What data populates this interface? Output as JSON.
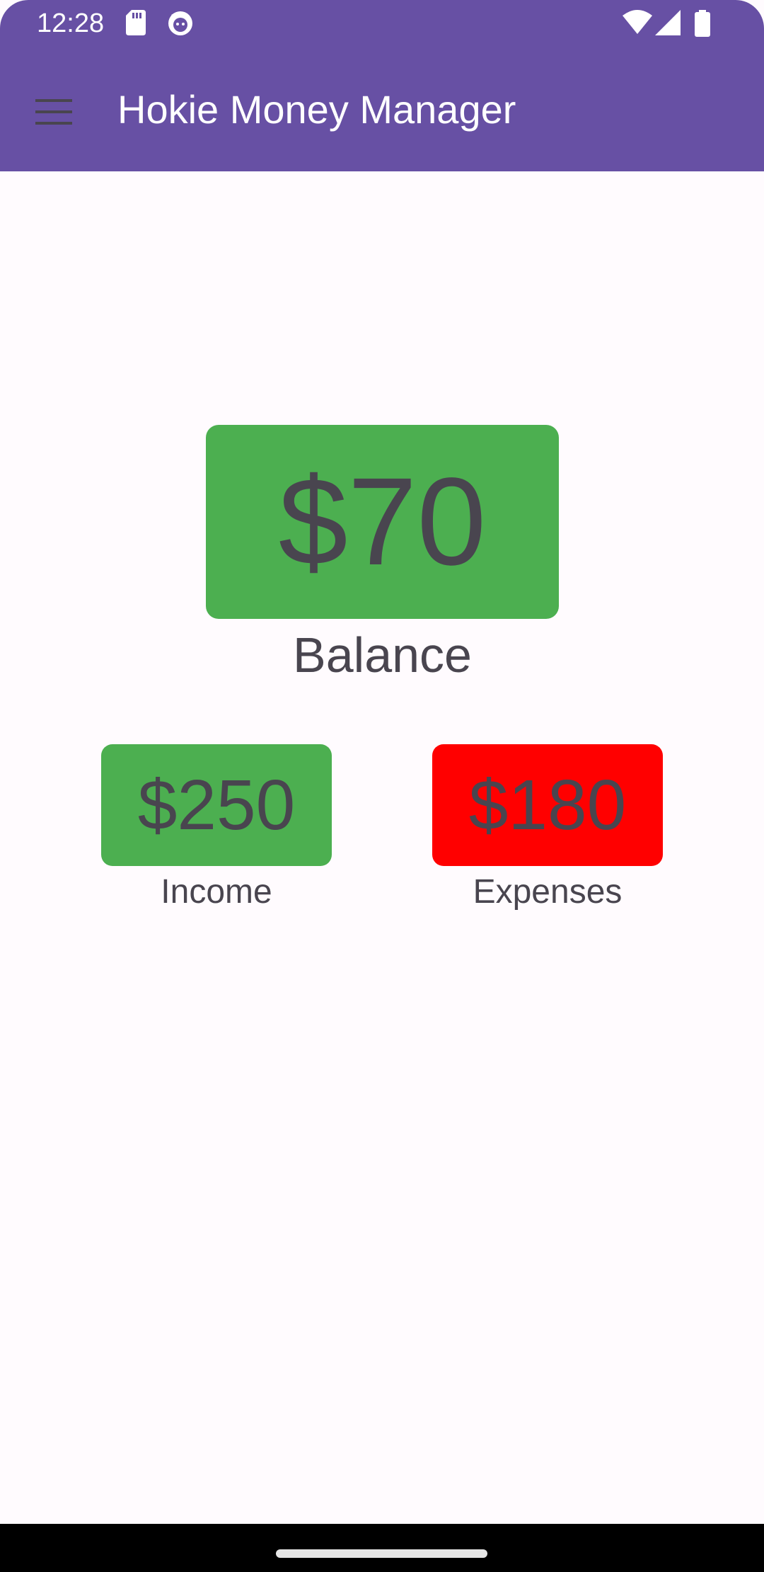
{
  "status_bar": {
    "time": "12:28",
    "icons": [
      "sd-card-icon",
      "android-face-icon",
      "wifi-icon",
      "cell-signal-icon",
      "battery-icon"
    ]
  },
  "app_bar": {
    "title": "Hokie Money Manager",
    "menu_icon": "menu-icon",
    "color": "#6750a4"
  },
  "summary": {
    "balance": {
      "value": "$70",
      "label": "Balance",
      "color": "#4caf50"
    },
    "income": {
      "value": "$250",
      "label": "Income",
      "color": "#4caf50"
    },
    "expenses": {
      "value": "$180",
      "label": "Expenses",
      "color": "#ff0000"
    }
  },
  "colors": {
    "background": "#fffbfe",
    "text": "#49454f"
  }
}
